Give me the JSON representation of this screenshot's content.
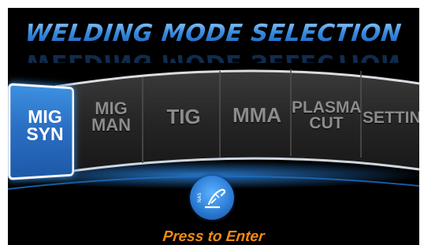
{
  "title": "WELDING MODE SELECTION",
  "modes": [
    {
      "line1": "MIG",
      "line2": "SYN",
      "selected": true
    },
    {
      "line1": "MIG",
      "line2": "MAN",
      "selected": false
    },
    {
      "line1": "TIG",
      "line2": "",
      "selected": false
    },
    {
      "line1": "MMA",
      "line2": "",
      "selected": false
    },
    {
      "line1": "PLASMA",
      "line2": "CUT",
      "selected": false
    },
    {
      "line1": "SETTING",
      "line2": "",
      "selected": false
    }
  ],
  "enter_button": {
    "icon": "welding-torch-icon",
    "badge": "NAS"
  },
  "press_label": "Press to Enter",
  "colors": {
    "accent_blue": "#2f80d8",
    "orange": "#f08a14",
    "background": "#000000"
  }
}
